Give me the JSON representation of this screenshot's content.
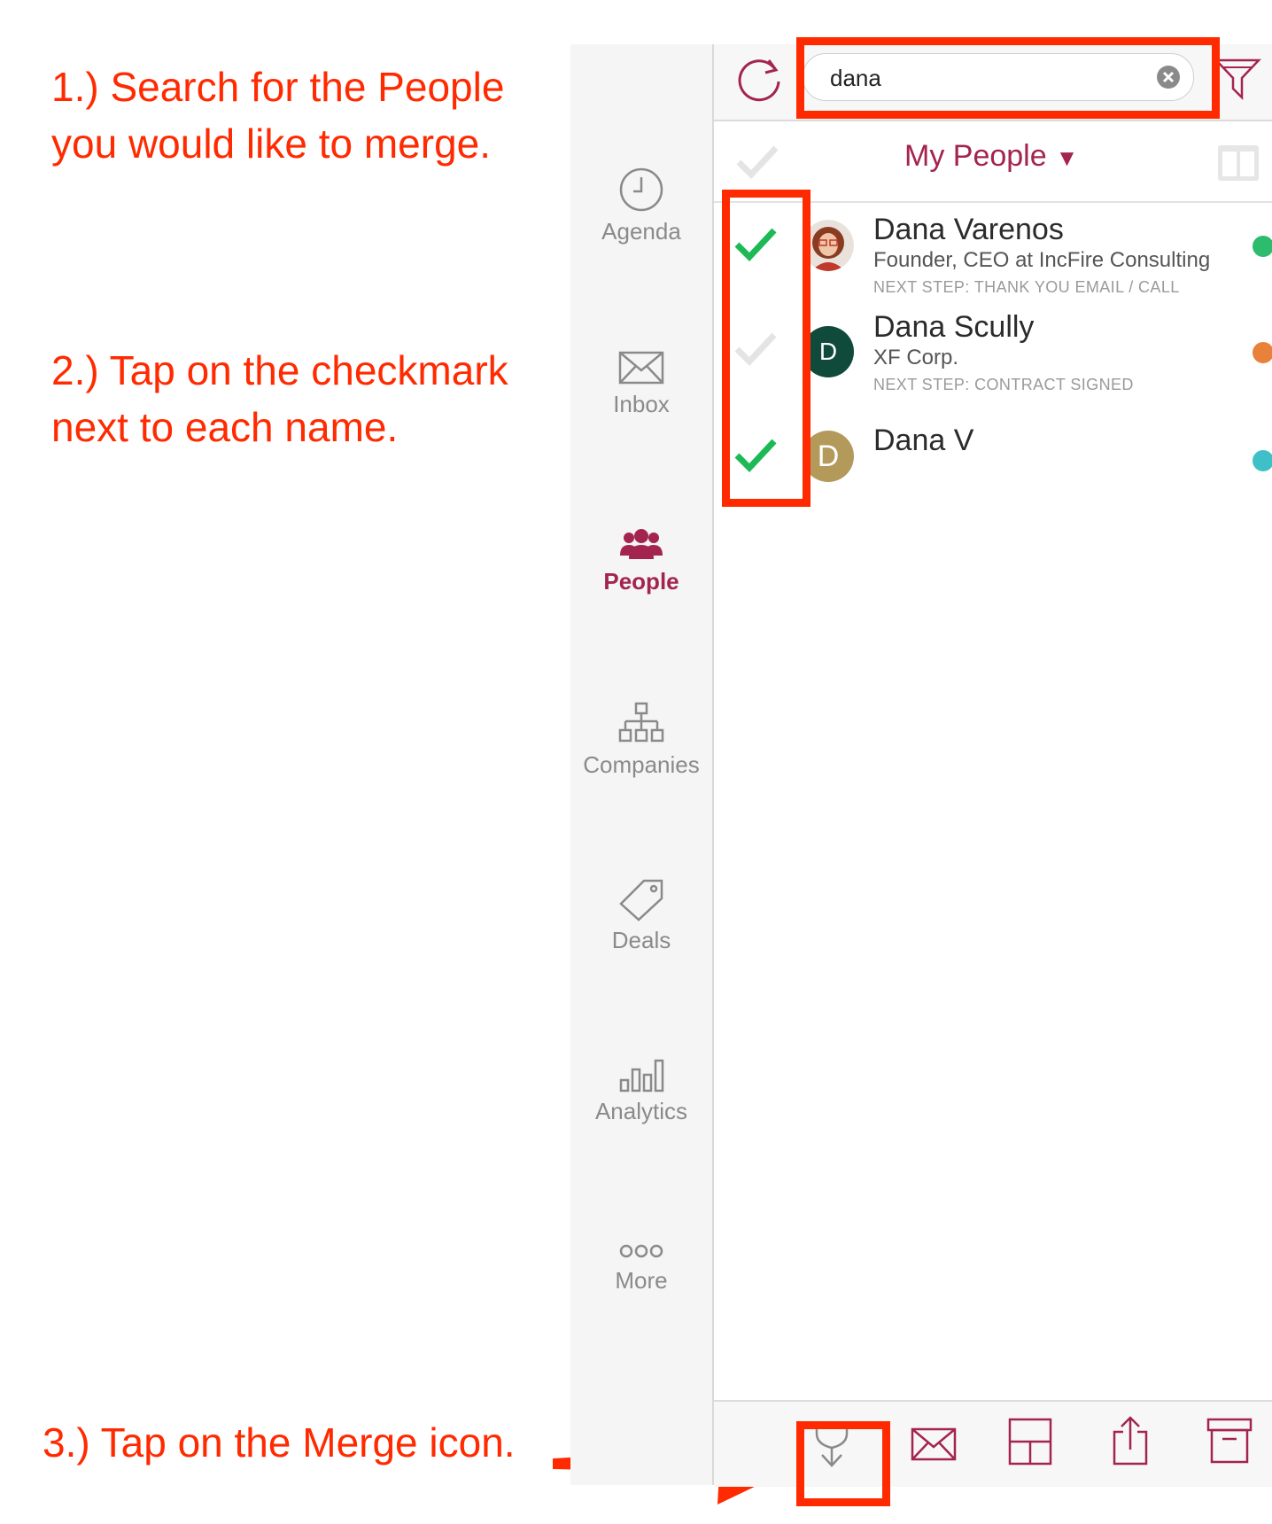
{
  "instructions": {
    "step1": "1.) Search for the People you would like to merge.",
    "step2": "2.) Tap on the checkmark next to each name.",
    "step3": "3.) Tap on the Merge icon."
  },
  "colors": {
    "annotation": "#ff2a00",
    "brand": "#a3244f",
    "check_on": "#1db954"
  },
  "sidebar": {
    "items": [
      {
        "label": "Agenda",
        "icon": "clock-icon"
      },
      {
        "label": "Inbox",
        "icon": "envelope-icon"
      },
      {
        "label": "People",
        "icon": "people-icon",
        "active": true
      },
      {
        "label": "Companies",
        "icon": "org-chart-icon"
      },
      {
        "label": "Deals",
        "icon": "tag-icon"
      },
      {
        "label": "Analytics",
        "icon": "bar-chart-icon"
      },
      {
        "label": "More",
        "icon": "more-icon"
      }
    ]
  },
  "toolbar": {
    "search_value": "dana"
  },
  "list": {
    "title": "My People",
    "caret": "▼",
    "people": [
      {
        "name": "Dana Varenos",
        "subtitle": "Founder, CEO at IncFire Consulting",
        "next_step": "NEXT STEP: THANK YOU EMAIL / CALL",
        "checked": true,
        "status_color": "#2dbb6e"
      },
      {
        "name": "Dana Scully",
        "subtitle": "XF Corp.",
        "next_step": "NEXT STEP: CONTRACT SIGNED",
        "initial": "D",
        "checked": false,
        "status_color": "#e8823a"
      },
      {
        "name": "Dana V",
        "initial": "D",
        "checked": true,
        "status_color": "#3fc0c8"
      }
    ]
  }
}
